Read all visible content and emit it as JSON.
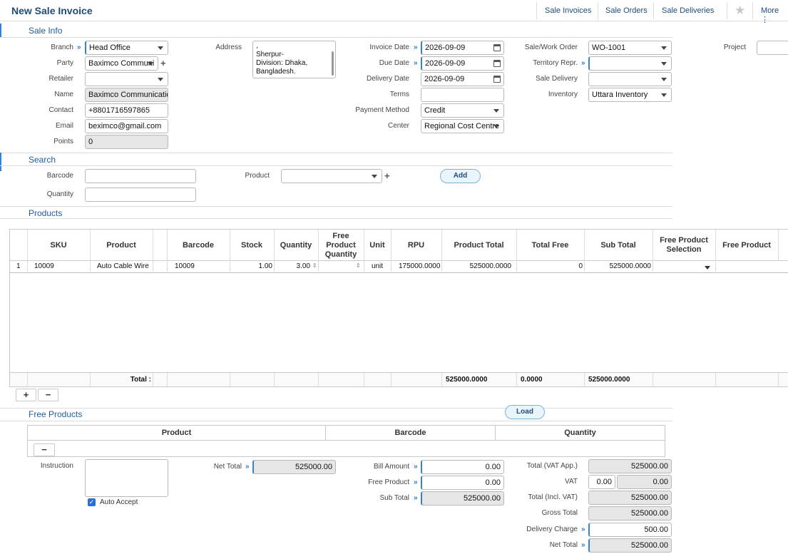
{
  "page": {
    "title": "New Sale Invoice"
  },
  "topnav": {
    "sale_invoices": "Sale Invoices",
    "sale_orders": "Sale Orders",
    "sale_deliveries": "Sale Deliveries",
    "more": "More ⋮"
  },
  "sections": {
    "sale_info": "Sale Info",
    "search": "Search",
    "products": "Products",
    "free_products": "Free Products"
  },
  "sale_info": {
    "branch": {
      "label": "Branch",
      "value": "Head Office"
    },
    "party": {
      "label": "Party",
      "value": "Baximco Communi"
    },
    "retailer": {
      "label": "Retailer",
      "value": ""
    },
    "name": {
      "label": "Name",
      "value": "Baximco Communication"
    },
    "contact": {
      "label": "Contact",
      "value": "+8801716597865"
    },
    "email": {
      "label": "Email",
      "value": "beximco@gmail.com"
    },
    "points": {
      "label": "Points",
      "value": "0"
    },
    "address": {
      "label": "Address",
      "line1": ",",
      "line2": "Sherpur-",
      "line3": "Division: Dhaka,",
      "line4": "Bangladesh."
    },
    "invoice_date": {
      "label": "Invoice Date",
      "value": "2026-09-09"
    },
    "due_date": {
      "label": "Due Date",
      "value": "2026-09-09"
    },
    "delivery_date": {
      "label": "Delivery Date",
      "value": "2026-09-09"
    },
    "terms": {
      "label": "Terms",
      "value": ""
    },
    "payment_method": {
      "label": "Payment Method",
      "value": "Credit"
    },
    "center": {
      "label": "Center",
      "value": "Regional Cost Centre"
    },
    "sale_work_order": {
      "label": "Sale/Work Order",
      "value": "WO-1001"
    },
    "territory_repr": {
      "label": "Territory Repr.",
      "value": ""
    },
    "sale_delivery": {
      "label": "Sale Delivery",
      "value": ""
    },
    "inventory": {
      "label": "Inventory",
      "value": "Uttara Inventory"
    },
    "project": {
      "label": "Project",
      "value": ""
    }
  },
  "search": {
    "barcode": {
      "label": "Barcode",
      "value": ""
    },
    "quantity": {
      "label": "Quantity",
      "value": ""
    },
    "product": {
      "label": "Product",
      "value": ""
    },
    "add_button": "Add"
  },
  "products_grid": {
    "headers": {
      "sku": "SKU",
      "product": "Product",
      "barcode": "Barcode",
      "stock": "Stock",
      "quantity": "Quantity",
      "free_qty_1": "Free",
      "free_qty_2": "Product",
      "free_qty_3": "Quantity",
      "unit": "Unit",
      "rpu": "RPU",
      "product_total": "Product Total",
      "total_free": "Total Free",
      "sub_total": "Sub Total",
      "fps_1": "Free Product",
      "fps_2": "Selection",
      "free_product": "Free Product"
    },
    "rows": [
      {
        "no": "1",
        "sku": "10009",
        "product": "Auto Cable Wire",
        "barcode": "10009",
        "stock": "1.00",
        "quantity": "3.00",
        "free_qty": "",
        "unit": "unit",
        "rpu": "175000.0000",
        "product_total": "525000.0000",
        "total_free": "0",
        "sub_total": "525000.0000"
      }
    ],
    "footer": {
      "label": "Total :",
      "product_total": "525000.0000",
      "total_free": "0.0000",
      "sub_total": "525000.0000"
    },
    "add_row": "+",
    "remove_row": "−"
  },
  "load_button": "Load",
  "free_products_grid": {
    "headers": {
      "product": "Product",
      "barcode": "Barcode",
      "quantity": "Quantity"
    },
    "remove_row": "−"
  },
  "summary": {
    "instruction": {
      "label": "Instruction",
      "value": ""
    },
    "auto_accept": {
      "label": "Auto Accept",
      "checked": true
    },
    "net_total_left": {
      "label": "Net Total",
      "value": "525000.00"
    },
    "bill_amount": {
      "label": "Bill Amount",
      "value": "0.00"
    },
    "free_product": {
      "label": "Free Product",
      "value": "0.00"
    },
    "sub_total": {
      "label": "Sub Total",
      "value": "525000.00"
    },
    "total_vat_app": {
      "label": "Total (VAT App.)",
      "value": "525000.00"
    },
    "vat": {
      "label": "VAT",
      "rate": "0.00",
      "value": "0.00"
    },
    "total_incl_vat": {
      "label": "Total (Incl. VAT)",
      "value": "525000.00"
    },
    "gross_total": {
      "label": "Gross Total",
      "value": "525000.00"
    },
    "delivery_charge": {
      "label": "Delivery Charge",
      "value": "500.00"
    },
    "net_total_right": {
      "label": "Net Total",
      "value": "525000.00"
    }
  }
}
